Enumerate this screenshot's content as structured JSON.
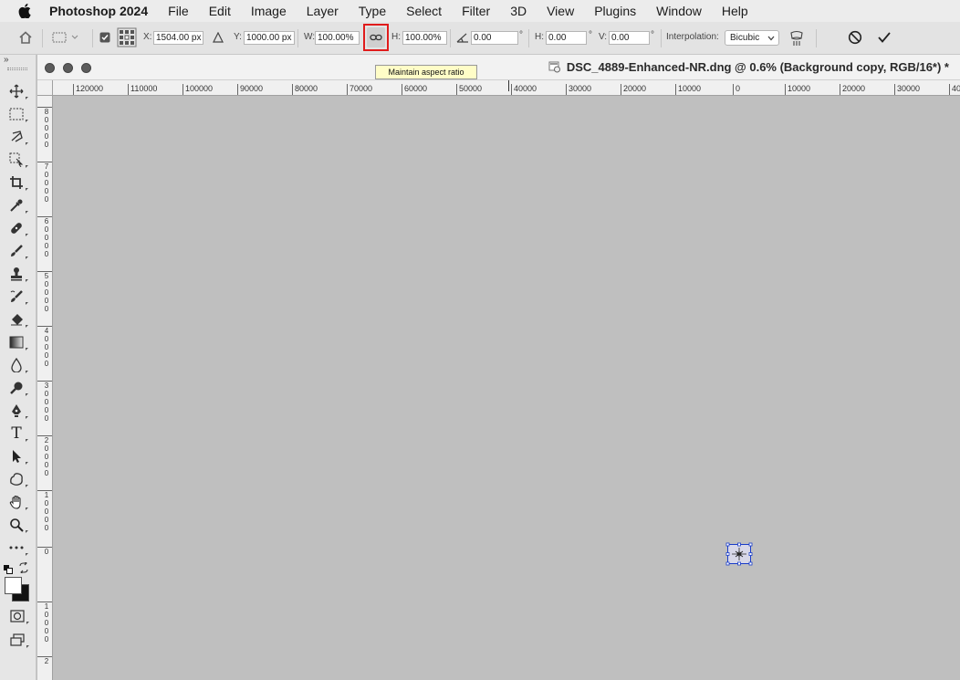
{
  "menubar": {
    "app_name": "Photoshop 2024",
    "items": [
      "File",
      "Edit",
      "Image",
      "Layer",
      "Type",
      "Select",
      "Filter",
      "3D",
      "View",
      "Plugins",
      "Window",
      "Help"
    ]
  },
  "options": {
    "x_label": "X:",
    "x_value": "1504.00 px",
    "y_label": "Y:",
    "y_value": "1000.00 px",
    "w_label": "W:",
    "w_value": "100.00%",
    "h_label": "H:",
    "h_value": "100.00%",
    "angle_value": "0.00",
    "degree": "°",
    "hskew_label": "H:",
    "hskew_value": "0.00",
    "vskew_label": "V:",
    "vskew_value": "0.00",
    "interp_label": "Interpolation:",
    "interp_value": "Bicubic",
    "link_active": true
  },
  "tooltip": "Maintain aspect ratio",
  "document": {
    "title": "DSC_4889-Enhanced-NR.dng @ 0.6% (Background copy, RGB/16*) *"
  },
  "hruler_labels": [
    "120000",
    "110000",
    "100000",
    "90000",
    "80000",
    "70000",
    "60000",
    "50000",
    "40000",
    "30000",
    "20000",
    "10000",
    "0",
    "10000",
    "20000",
    "30000",
    "40"
  ],
  "vruler_labels": [
    "8\n0\n0\n0\n0",
    "7\n0\n0\n0\n0",
    "6\n0\n0\n0\n0",
    "5\n0\n0\n0\n0",
    "4\n0\n0\n0\n0",
    "3\n0\n0\n0\n0",
    "2\n0\n0\n0\n0",
    "1\n0\n0\n0\n0",
    "0",
    "1\n0\n0\n0\n0",
    "2"
  ],
  "tools": [
    "move",
    "marquee",
    "lasso",
    "object-select",
    "crop",
    "eyedropper",
    "healing",
    "brush",
    "stamp",
    "history-brush",
    "eraser",
    "gradient",
    "blur",
    "dodge",
    "pen",
    "type",
    "path-select",
    "shape",
    "hand",
    "zoom",
    "more"
  ],
  "colors": {
    "accent_red": "#e01b1b",
    "transform_blue": "#1a3cc8"
  }
}
